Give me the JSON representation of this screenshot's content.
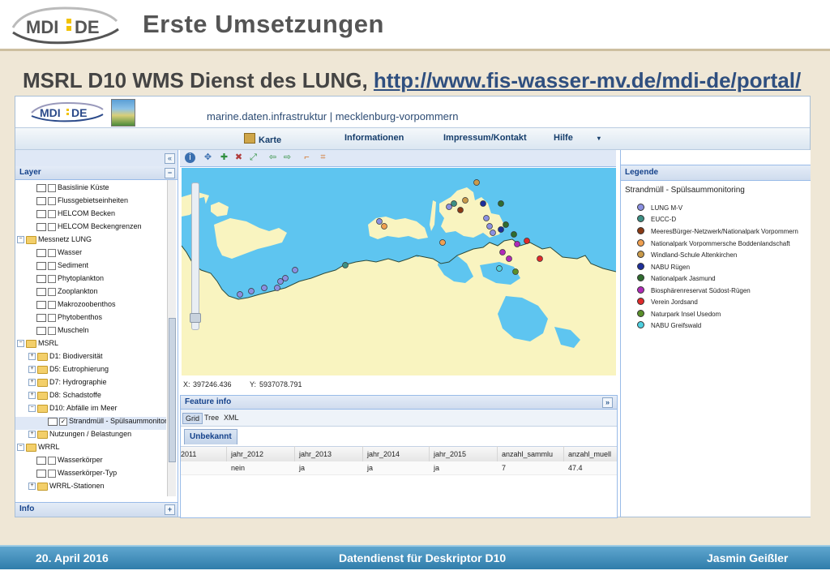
{
  "slide": {
    "title": "Erste Umsetzungen",
    "subtitle": "MSRL D10 WMS Dienst des LUNG,",
    "url": "http://www.fis-wasser-mv.de/mdi-de/portal/",
    "logo_text": "MDI DE",
    "footer_date": "20. April 2016",
    "footer_center": "Datendienst für Deskriptor D10",
    "footer_author": "Jasmin Geißler"
  },
  "app": {
    "logo_text": "MDI DE",
    "tagline": "marine.daten.infrastruktur | mecklenburg-vorpommern",
    "menu": [
      {
        "label": "Karte"
      },
      {
        "label": "Informationen"
      },
      {
        "label": "Impressum/Kontakt"
      },
      {
        "label": "Hilfe"
      }
    ]
  },
  "layer_panel": {
    "title": "Layer",
    "info_title": "Info",
    "items": [
      {
        "label": "Basislinie Küste"
      },
      {
        "label": "Flussgebietseinheiten"
      },
      {
        "label": "HELCOM Becken"
      },
      {
        "label": "HELCOM Beckengrenzen"
      },
      {
        "label": "Messnetz LUNG"
      },
      {
        "label": "Wasser"
      },
      {
        "label": "Sediment"
      },
      {
        "label": "Phytoplankton"
      },
      {
        "label": "Zooplankton"
      },
      {
        "label": "Makrozoobenthos"
      },
      {
        "label": "Phytobenthos"
      },
      {
        "label": "Muscheln"
      },
      {
        "label": "MSRL"
      },
      {
        "label": "D1: Biodiversität"
      },
      {
        "label": "D5: Eutrophierung"
      },
      {
        "label": "D7: Hydrographie"
      },
      {
        "label": "D8: Schadstoffe"
      },
      {
        "label": "D10: Abfälle im Meer"
      },
      {
        "label": "Strandmüll - Spülsaummonitor"
      },
      {
        "label": "Nutzungen / Belastungen"
      },
      {
        "label": "WRRL"
      },
      {
        "label": "Wasserkörper"
      },
      {
        "label": "Wasserkörper-Typ"
      },
      {
        "label": "WRRL-Stationen"
      }
    ]
  },
  "map": {
    "x_label": "X:",
    "x_value": "397246.436",
    "y_label": "Y:",
    "y_value": "5937078.791"
  },
  "feature_info": {
    "title": "Feature info",
    "tabs": [
      "Grid",
      "Tree",
      "XML"
    ],
    "subtab": "Unbekannt",
    "columns": [
      "2011",
      "jahr_2012",
      "jahr_2013",
      "jahr_2014",
      "jahr_2015",
      "anzahl_sammlu",
      "anzahl_muell"
    ],
    "row": [
      "",
      "nein",
      "ja",
      "ja",
      "ja",
      "7",
      "47.4"
    ]
  },
  "legend": {
    "title": "Legende",
    "layer_title": "Strandmüll - Spülsaummonitoring",
    "items": [
      {
        "label": "LUNG M-V",
        "color": "#8a8fe0"
      },
      {
        "label": "EUCC-D",
        "color": "#3d8f84"
      },
      {
        "label": "MeeresBürger-Netzwerk/Nationalpark Vorpommern",
        "color": "#8a3a14"
      },
      {
        "label": "Nationalpark Vorpommersche Boddenlandschaft",
        "color": "#f0a050"
      },
      {
        "label": "Windland-Schule Altenkirchen",
        "color": "#c99a4a"
      },
      {
        "label": "NABU Rügen",
        "color": "#1d2f9a"
      },
      {
        "label": "Nationalpark Jasmund",
        "color": "#2f6b2f"
      },
      {
        "label": "Biosphärenreservat Südost-Rügen",
        "color": "#b02ab8"
      },
      {
        "label": "Verein Jordsand",
        "color": "#e02a2a"
      },
      {
        "label": "Naturpark Insel Usedom",
        "color": "#5a8f2a"
      },
      {
        "label": "NABU Greifswald",
        "color": "#4ed0e0"
      }
    ]
  }
}
